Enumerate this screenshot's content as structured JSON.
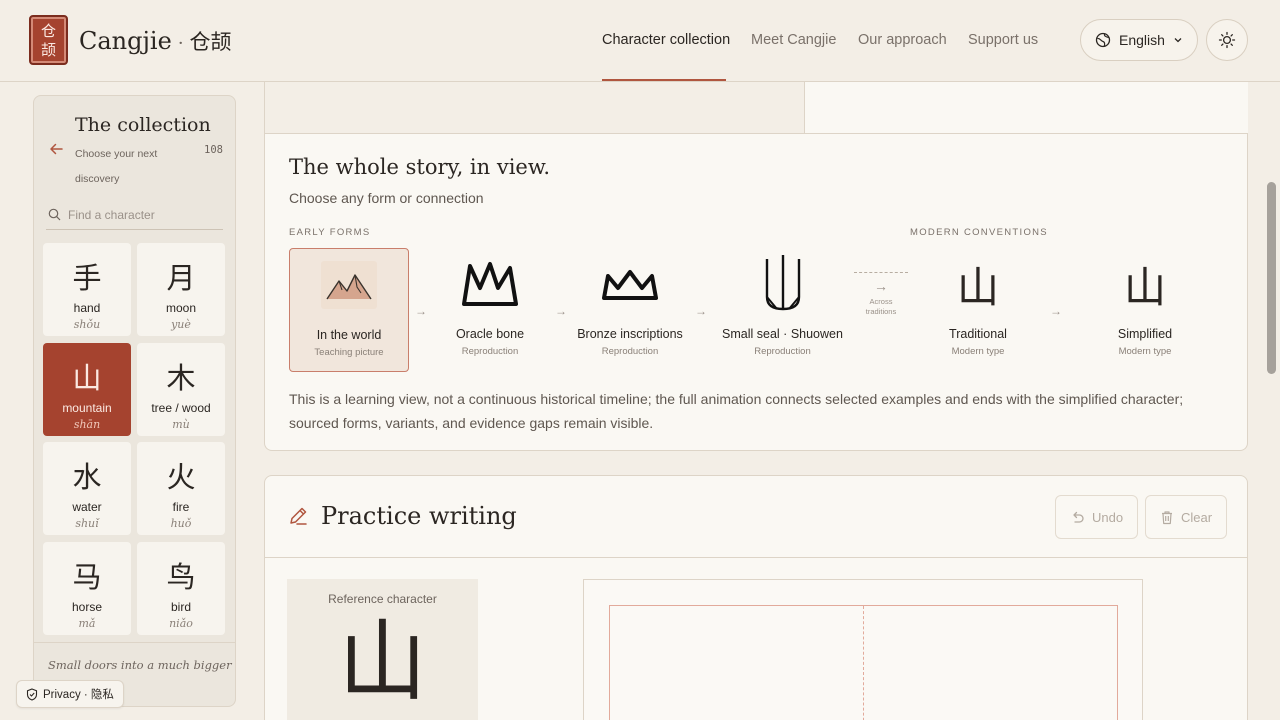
{
  "brand": {
    "logo_chars": [
      "仓",
      "颉"
    ],
    "name": "Cangjie",
    "separator": "·",
    "han": "仓颉",
    "logo_color": "#a5432f"
  },
  "nav": {
    "items": [
      "Character collection",
      "Meet Cangjie",
      "Our approach",
      "Support us"
    ],
    "active": "Character collection"
  },
  "language": {
    "label": "English",
    "icons": [
      "globe-icon",
      "chevron-down-icon"
    ]
  },
  "theme_toggle": {
    "icon": "sun-icon"
  },
  "sidebar": {
    "title": "The collection",
    "subtitle": "Choose your next discovery",
    "count": "108",
    "search_placeholder": "Find a character",
    "cards": [
      {
        "char": "手",
        "en": "hand",
        "py": "shǒu",
        "active": false
      },
      {
        "char": "月",
        "en": "moon",
        "py": "yuè",
        "active": false
      },
      {
        "char": "山",
        "en": "mountain",
        "py": "shān",
        "active": true
      },
      {
        "char": "木",
        "en": "tree / wood",
        "py": "mù",
        "active": false
      },
      {
        "char": "水",
        "en": "water",
        "py": "shuǐ",
        "active": false
      },
      {
        "char": "火",
        "en": "fire",
        "py": "huǒ",
        "active": false
      },
      {
        "char": "马",
        "en": "horse",
        "py": "mǎ",
        "active": false
      },
      {
        "char": "鸟",
        "en": "bird",
        "py": "niǎo",
        "active": false
      }
    ],
    "footer": "Small doors into a much bigger"
  },
  "story": {
    "title": "The whole story, in view.",
    "subtitle": "Choose any form or connection",
    "label_early": "EARLY FORMS",
    "label_modern": "MODERN CONVENTIONS",
    "forms": [
      {
        "title": "In the world",
        "sub": "Teaching picture",
        "selected": true
      },
      {
        "title": "Oracle bone",
        "sub": "Reproduction",
        "selected": false
      },
      {
        "title": "Bronze inscriptions",
        "sub": "Reproduction",
        "selected": false
      },
      {
        "title": "Small seal · Shuowen",
        "sub": "Reproduction",
        "selected": false
      },
      {
        "title": "Traditional",
        "sub": "Modern type",
        "char": "山",
        "selected": false
      },
      {
        "title": "Simplified",
        "sub": "Modern type",
        "char": "山",
        "selected": false
      }
    ],
    "across_label": "Across traditions",
    "note": "This is a learning view, not a continuous historical timeline; the full animation connects selected examples and ends with the simplified character; sourced forms, variants, and evidence gaps remain visible."
  },
  "practice": {
    "title": "Practice writing",
    "undo": "Undo",
    "clear": "Clear",
    "reference_label": "Reference character",
    "reference_char": "山"
  },
  "privacy": {
    "label": "Privacy · 隐私"
  }
}
